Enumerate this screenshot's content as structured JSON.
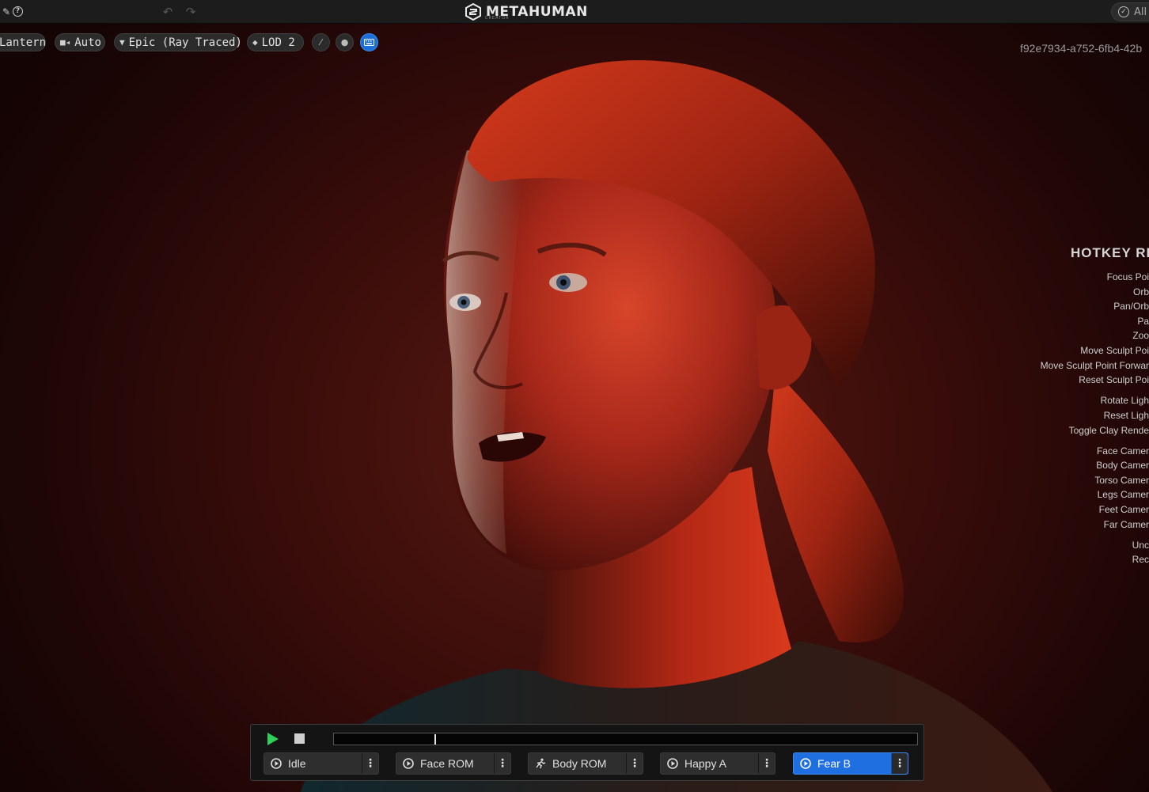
{
  "titlebar": {
    "logo_text": "METAHUMAN",
    "logo_subtext": "CREATOR",
    "all_label": "All",
    "icons": [
      "edit-icon",
      "help-icon",
      "undo-icon",
      "redo-icon"
    ]
  },
  "viewport_toolbar": {
    "lighting": "Lantern",
    "camera": "Auto",
    "quality": "Epic (Ray Traced)",
    "lod": "LOD 2",
    "icons": [
      "camera-icon",
      "quality-gem-icon",
      "lod-cube-icon",
      "brush-icon",
      "head-icon",
      "keyboard-icon"
    ]
  },
  "asset_id": "f92e7934-a752-6fb4-42b",
  "hotkey_reference": {
    "title": "HOTKEY REF",
    "groups": [
      [
        "Focus Poi",
        "Orb",
        "Pan/Orb",
        "Pa",
        "Zoo",
        "Move Sculpt Poi",
        "Move Sculpt Point Forwar",
        "Reset Sculpt Poi"
      ],
      [
        "Rotate Ligh",
        "Reset Ligh",
        "Toggle Clay Rende"
      ],
      [
        "Face Camer",
        "Body Camer",
        "Torso Camer",
        "Legs Camer",
        "Feet Camer",
        "Far Camer"
      ],
      [
        "Unc",
        "Rec"
      ]
    ]
  },
  "animation_panel": {
    "playhead_fraction": 0.172,
    "colors": {
      "play": "#2fcf5a",
      "active": "#1f6fe0"
    },
    "animations": [
      {
        "label": "Idle",
        "icon": "play-circle-icon",
        "active": false
      },
      {
        "label": "Face ROM",
        "icon": "play-circle-icon",
        "active": false
      },
      {
        "label": "Body ROM",
        "icon": "running-person-icon",
        "active": false
      },
      {
        "label": "Happy A",
        "icon": "play-circle-icon",
        "active": false
      },
      {
        "label": "Fear B",
        "icon": "play-circle-icon",
        "active": true
      }
    ]
  }
}
